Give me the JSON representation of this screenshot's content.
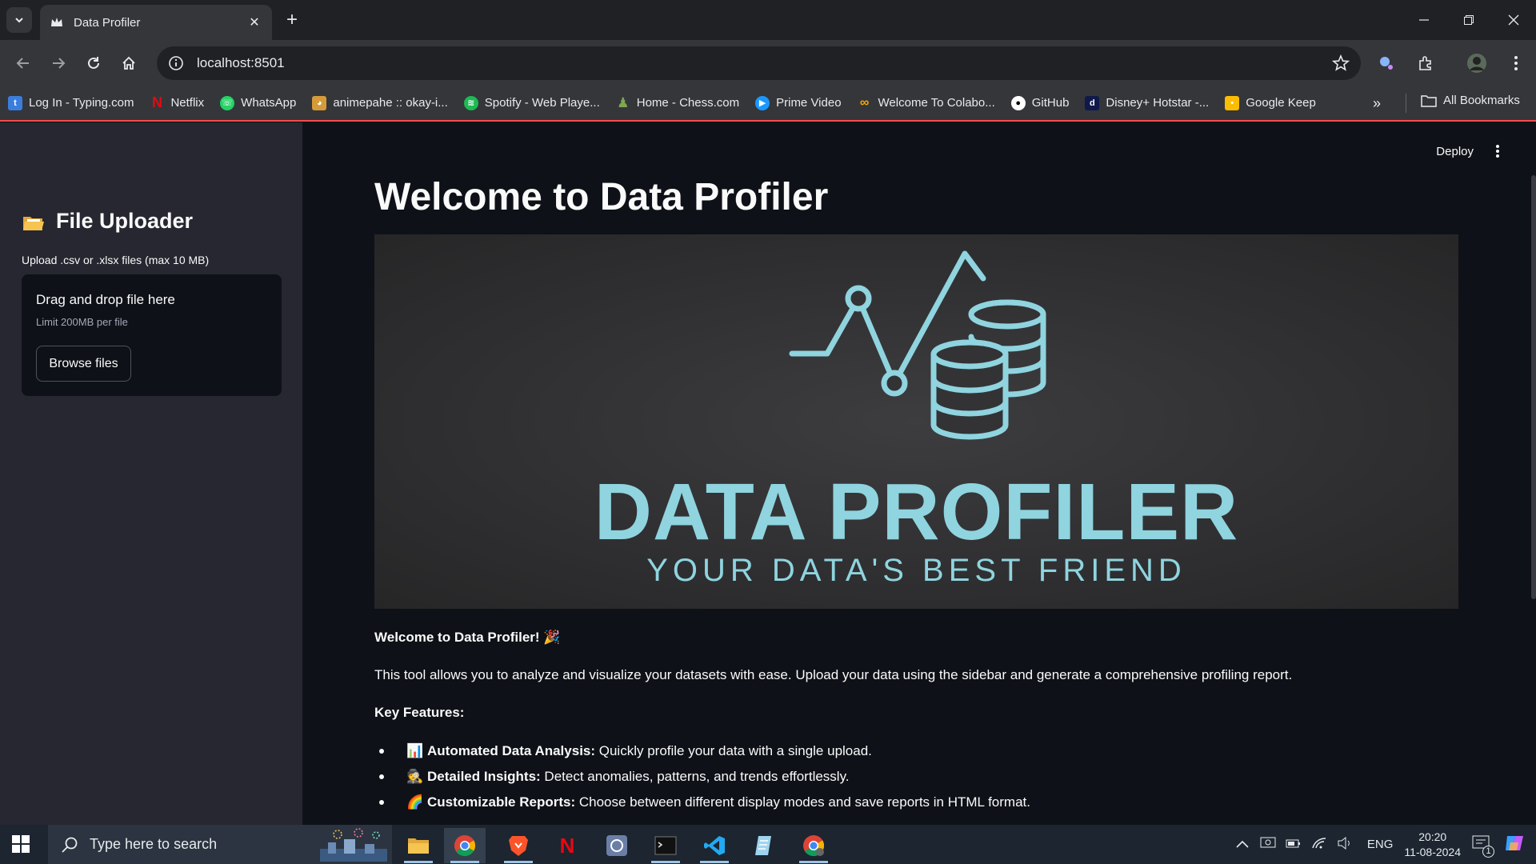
{
  "browser": {
    "tab_title": "Data Profiler",
    "url": "localhost:8501",
    "bookmarks": [
      {
        "label": "Log In - Typing.com",
        "color": "#3b7ddd",
        "glyph": "t"
      },
      {
        "label": "Netflix",
        "color": "#e50914",
        "glyph": "N"
      },
      {
        "label": "WhatsApp",
        "color": "#25d366",
        "glyph": ""
      },
      {
        "label": "animepahe :: okay-i...",
        "color": "#d49b3a",
        "glyph": ""
      },
      {
        "label": "Spotify - Web Playe...",
        "color": "#1db954",
        "glyph": ""
      },
      {
        "label": "Home - Chess.com",
        "color": "#7fa650",
        "glyph": ""
      },
      {
        "label": "Prime Video",
        "color": "#1a98ff",
        "glyph": "▶"
      },
      {
        "label": "Welcome To Colabo...",
        "color": "#f9ab00",
        "glyph": "∞"
      },
      {
        "label": "GitHub",
        "color": "#ffffff",
        "glyph": ""
      },
      {
        "label": "Disney+ Hotstar -...",
        "color": "#0f1a4a",
        "glyph": "d"
      },
      {
        "label": "Google Keep",
        "color": "#fbbc04",
        "glyph": ""
      }
    ],
    "all_bookmarks_label": "All Bookmarks"
  },
  "sidebar": {
    "title": "File Uploader",
    "upload_label": "Upload .csv or .xlsx files (max 10 MB)",
    "dropzone_title": "Drag and drop file here",
    "dropzone_limit": "Limit 200MB per file",
    "browse_label": "Browse files"
  },
  "header": {
    "deploy_label": "Deploy"
  },
  "main": {
    "title": "Welcome to Data Profiler",
    "banner_title": "DATA PROFILER",
    "banner_subtitle": "YOUR DATA'S BEST FRIEND",
    "welcome": "Welcome to Data Profiler! 🎉",
    "description": "This tool allows you to analyze and visualize your datasets with ease. Upload your data using the sidebar and generate a comprehensive profiling report.",
    "key_features_label": "Key Features:",
    "features": [
      {
        "icon": "📊",
        "name": "Automated Data Analysis:",
        "text": " Quickly profile your data with a single upload."
      },
      {
        "icon": "🕵",
        "name": "Detailed Insights:",
        "text": " Detect anomalies, patterns, and trends effortlessly."
      },
      {
        "icon": "🌈",
        "name": "Customizable Reports:",
        "text": " Choose between different display modes and save reports in HTML format."
      }
    ]
  },
  "taskbar": {
    "search_placeholder": "Type here to search",
    "language": "ENG",
    "time": "20:20",
    "date": "11-08-2024",
    "notification_count": "1"
  },
  "colors": {
    "accent": "#ff4b4b",
    "logo": "#8fd4df",
    "sidebar_bg": "#262730",
    "main_bg": "#0e1117"
  }
}
